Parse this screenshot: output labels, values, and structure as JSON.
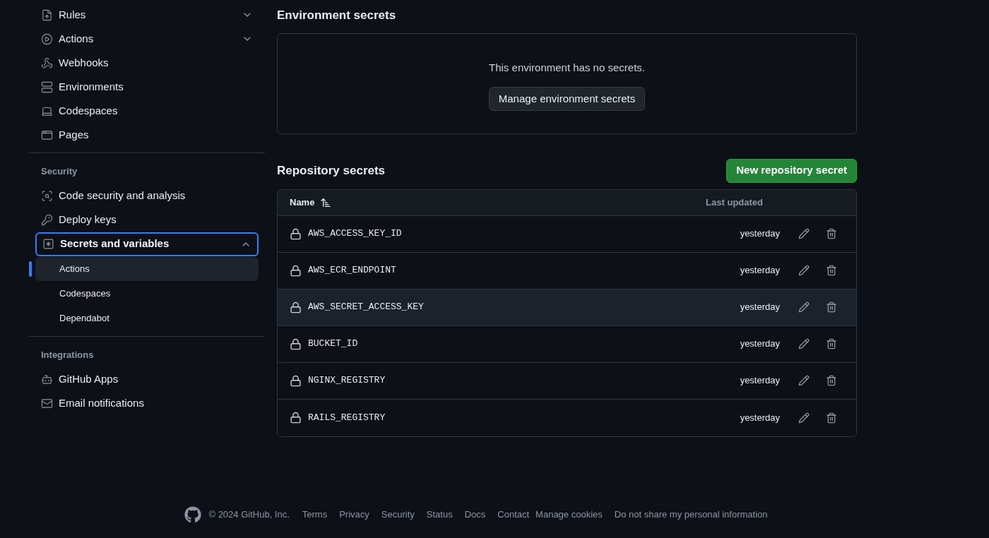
{
  "sidebar": {
    "groups": [
      {
        "items": [
          {
            "label": "Rules",
            "expanded": false,
            "selected": false
          },
          {
            "label": "Actions",
            "expanded": false,
            "selected": false
          },
          {
            "label": "Webhooks",
            "selected": false
          },
          {
            "label": "Environments",
            "selected": false
          },
          {
            "label": "Codespaces",
            "selected": false
          },
          {
            "label": "Pages",
            "selected": false
          }
        ]
      },
      {
        "heading": "Security",
        "items": [
          {
            "label": "Code security and analysis",
            "selected": false
          },
          {
            "label": "Deploy keys",
            "selected": false
          },
          {
            "label": "Secrets and variables",
            "expanded": true,
            "selected": true,
            "children": [
              {
                "label": "Actions",
                "selected": true
              },
              {
                "label": "Codespaces",
                "selected": false
              },
              {
                "label": "Dependabot",
                "selected": false
              }
            ]
          }
        ]
      },
      {
        "heading": "Integrations",
        "items": [
          {
            "label": "GitHub Apps",
            "selected": false
          },
          {
            "label": "Email notifications",
            "selected": false
          }
        ]
      }
    ]
  },
  "environment_secrets": {
    "title": "Environment secrets",
    "empty_message": "This environment has no secrets.",
    "button": "Manage environment secrets"
  },
  "repository_secrets": {
    "title": "Repository secrets",
    "new_button": "New repository secret",
    "columns": [
      "Name",
      "Last updated"
    ],
    "rows": [
      {
        "name": "AWS_ACCESS_KEY_ID",
        "updated": "yesterday",
        "hovered": false
      },
      {
        "name": "AWS_ECR_ENDPOINT",
        "updated": "yesterday",
        "hovered": false
      },
      {
        "name": "AWS_SECRET_ACCESS_KEY",
        "updated": "yesterday",
        "hovered": true
      },
      {
        "name": "BUCKET_ID",
        "updated": "yesterday",
        "hovered": false
      },
      {
        "name": "NGINX_REGISTRY",
        "updated": "yesterday",
        "hovered": false
      },
      {
        "name": "RAILS_REGISTRY",
        "updated": "yesterday",
        "hovered": false
      }
    ]
  },
  "footer": {
    "copyright": "© 2024 GitHub, Inc.",
    "links": [
      "Terms",
      "Privacy",
      "Security",
      "Status",
      "Docs",
      "Contact",
      "Manage cookies",
      "Do not share my personal information"
    ]
  }
}
